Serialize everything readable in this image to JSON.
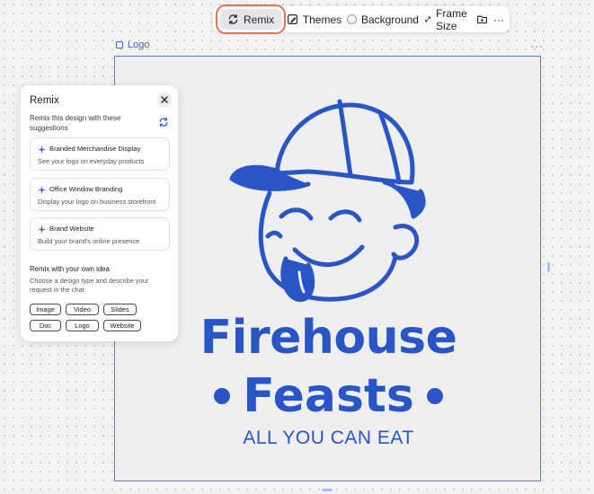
{
  "toolbar": {
    "remix_label": "Remix",
    "themes_label": "Themes",
    "background_label": "Background",
    "frame_size_label": "Frame Size",
    "more_label": "···"
  },
  "canvas": {
    "frame_label": "Logo",
    "frame_more": "···"
  },
  "logo": {
    "line1": "Firehouse",
    "line2": "Feasts",
    "tagline": "ALL YOU CAN EAT",
    "color": "#2a55c6"
  },
  "remix_panel": {
    "title": "Remix",
    "subtitle": "Remix this design with these suggestions",
    "suggestions": [
      {
        "title": "Branded Merchandise Display",
        "description": "See your logo on everyday products"
      },
      {
        "title": "Office Window Branding",
        "description": "Display your logo on business storefront"
      },
      {
        "title": "Brand Website",
        "description": "Build your brand's online presence"
      }
    ],
    "own_idea_heading": "Remix with your own idea",
    "own_idea_desc": "Choose a design type and describe your request in the chat",
    "types": [
      "Image",
      "Video",
      "Slides",
      "Doc",
      "Logo",
      "Website"
    ]
  },
  "colors": {
    "accent": "#3c5ee8",
    "highlight": "#ee6e4f",
    "brand_blue": "#2a55c6"
  },
  "icons": [
    "remix-icon",
    "themes-icon",
    "background-swatch-icon",
    "frame-size-icon",
    "add-frame-icon",
    "more-icon",
    "close-icon",
    "refresh-icon",
    "sparkle-icon"
  ]
}
